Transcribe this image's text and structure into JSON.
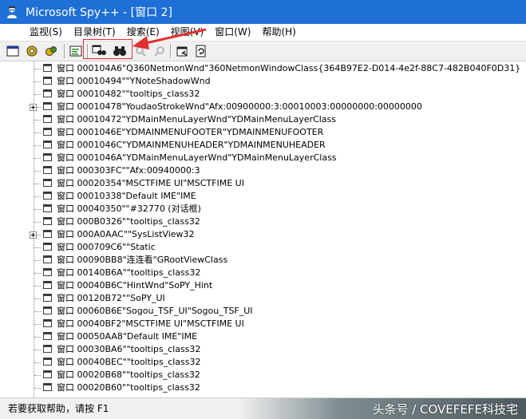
{
  "window": {
    "title": "Microsoft Spy++ - [窗口 2]"
  },
  "menu": [
    "监视(S)",
    "目录树(T)",
    "搜索(E)",
    "视图(V)",
    "窗口(W)",
    "帮助(H)"
  ],
  "tree": {
    "rows": [
      {
        "text": "窗口 000104A6\"Q360NetmonWnd\"360NetmonWindowClass{364B97E2-D014-4e2f-88C7-482B040F0D31}",
        "expandable": false
      },
      {
        "text": "窗口 00010494\"\"YNoteShadowWnd",
        "expandable": false
      },
      {
        "text": "窗口 00010482\"\"tooltips_class32",
        "expandable": false
      },
      {
        "text": "窗口 00010478\"YoudaoStrokeWnd\"Afx:00900000:3:00010003:00000000:00000000",
        "expandable": true
      },
      {
        "text": "窗口 00010472\"YDMainMenuLayerWnd\"YDMainMenuLayerClass",
        "expandable": false
      },
      {
        "text": "窗口 0001046E\"YDMAINMENUFOOTER\"YDMAINMENUFOOTER",
        "expandable": false
      },
      {
        "text": "窗口 0001046C\"YDMAINMENUHEADER\"YDMAINMENUHEADER",
        "expandable": false
      },
      {
        "text": "窗口 0001046A\"YDMainMenuLayerWnd\"YDMainMenuLayerClass",
        "expandable": false
      },
      {
        "text": "窗口 000303FC\"\"Afx:00940000:3",
        "expandable": false
      },
      {
        "text": "窗口 00020354\"MSCTFIME UI\"MSCTFIME UI",
        "expandable": false
      },
      {
        "text": "窗口 00010338\"Default IME\"IME",
        "expandable": false
      },
      {
        "text": "窗口 00040350\"\"#32770 (对话框)",
        "expandable": false
      },
      {
        "text": "窗口 000B0326\"\"tooltips_class32",
        "expandable": false
      },
      {
        "text": "窗口 000A0AAC\"\"SysListView32",
        "expandable": true
      },
      {
        "text": "窗口 000709C6\"\"Static",
        "expandable": false
      },
      {
        "text": "窗口 00090BB8\"连连看\"GRootViewClass",
        "expandable": false
      },
      {
        "text": "窗口 00140B6A\"\"tooltips_class32",
        "expandable": false
      },
      {
        "text": "窗口 00040B6C\"HintWnd\"SoPY_Hint",
        "expandable": false
      },
      {
        "text": "窗口 00120B72\"\"SoPY_UI",
        "expandable": false
      },
      {
        "text": "窗口 00060B6E\"Sogou_TSF_UI\"Sogou_TSF_UI",
        "expandable": false
      },
      {
        "text": "窗口 00040BF2\"MSCTFIME UI\"MSCTFIME UI",
        "expandable": false
      },
      {
        "text": "窗口 00050AA8\"Default IME\"IME",
        "expandable": false
      },
      {
        "text": "窗口 00030BA6\"\"tooltips_class32",
        "expandable": false
      },
      {
        "text": "窗口 00040BEC\"\"tooltips_class32",
        "expandable": false
      },
      {
        "text": "窗口 00020B68\"\"tooltips_class32",
        "expandable": false
      },
      {
        "text": "窗口 00020B60\"\"tooltips_class32",
        "expandable": false
      }
    ]
  },
  "statusbar": {
    "text": "若要获取帮助，请按 F1"
  },
  "watermark": "头条号 / COVEFEFE科技宅"
}
